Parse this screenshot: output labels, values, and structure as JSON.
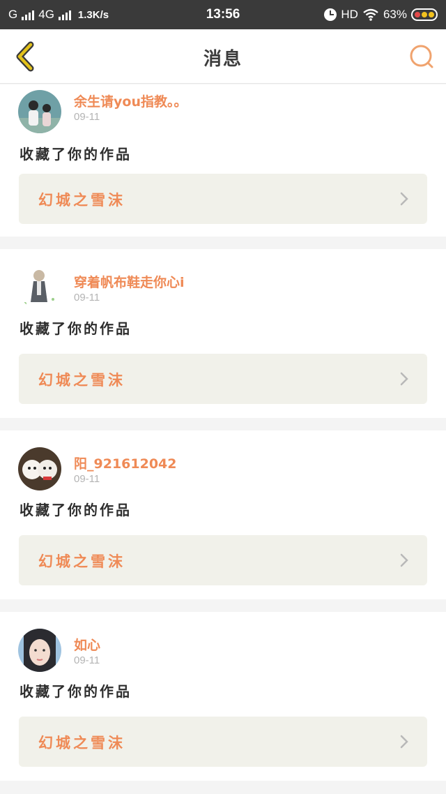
{
  "status_bar": {
    "carrier_left": "G",
    "network": "4G",
    "speed": "1.3K/s",
    "time": "13:56",
    "hd": "HD",
    "battery": "63%"
  },
  "nav": {
    "title": "消息",
    "back_icon": "chevron-left-icon",
    "search_icon": "search-icon"
  },
  "colors": {
    "accent": "#ef8a56",
    "back_icon": "#e3c21b",
    "work_bg": "#f1f1ea"
  },
  "messages": [
    {
      "username": "余生请you指教。。",
      "date": "09-11",
      "action": "收藏了你的作品",
      "work_title": "幻城之雪沫",
      "avatar": "couple-photo"
    },
    {
      "username": "穿着帆布鞋走你心i",
      "date": "09-11",
      "action": "收藏了你的作品",
      "work_title": "幻城之雪沫",
      "avatar": "anime-boy"
    },
    {
      "username": "阳_921612042",
      "date": "09-11",
      "action": "收藏了你的作品",
      "work_title": "幻城之雪沫",
      "avatar": "white-puppies"
    },
    {
      "username": "如心",
      "date": "09-11",
      "action": "收藏了你的作品",
      "work_title": "幻城之雪沫",
      "avatar": "woman-portrait"
    }
  ]
}
